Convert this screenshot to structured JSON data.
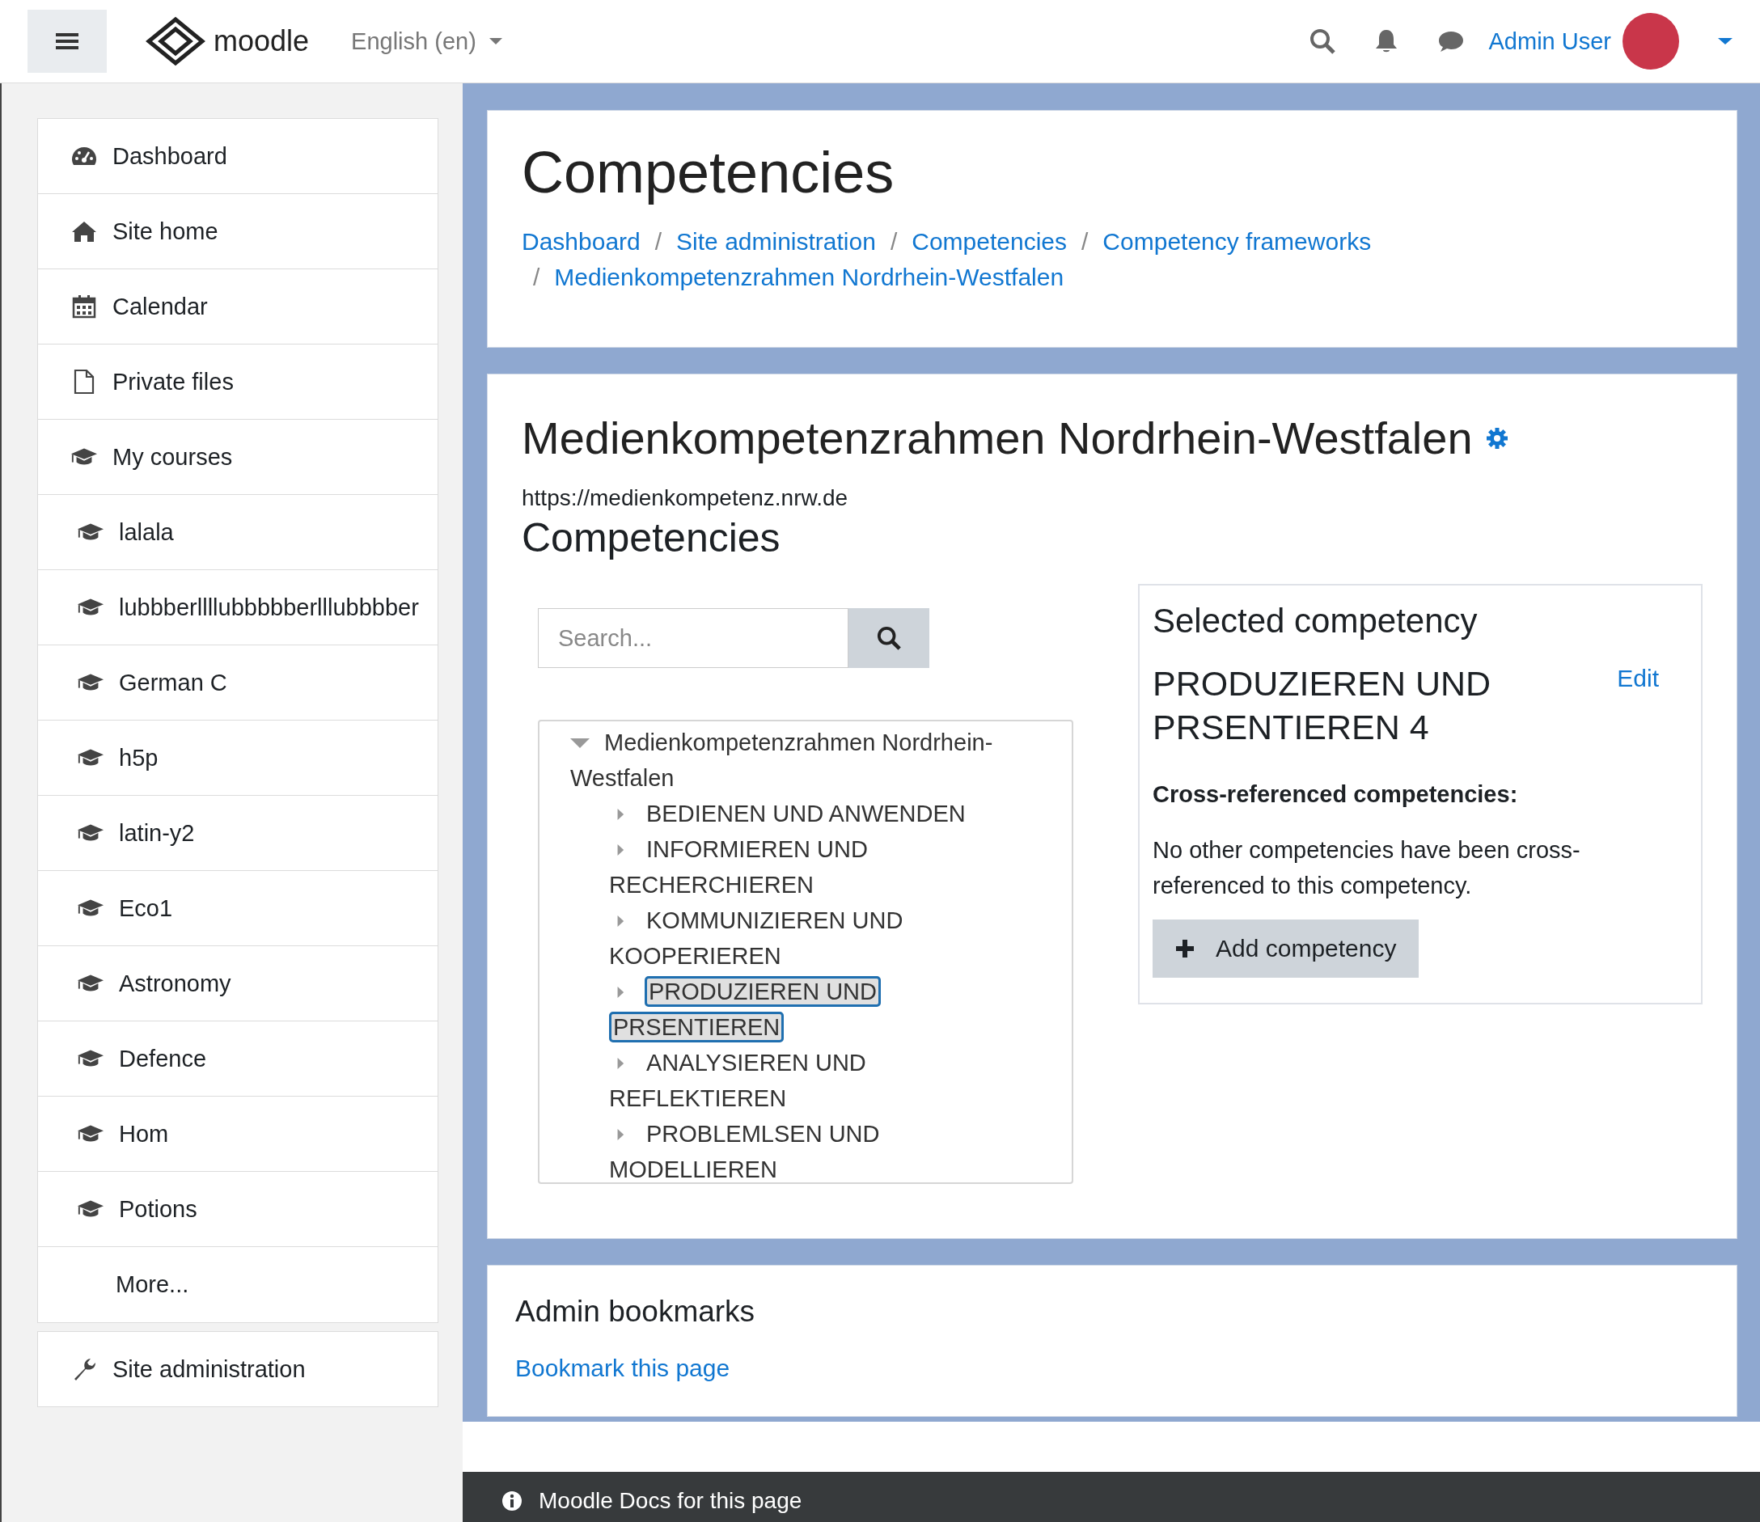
{
  "header": {
    "brand": "moodle",
    "language": "English (en)",
    "user": "Admin User"
  },
  "sidebar": {
    "items": [
      {
        "label": "Dashboard",
        "kind": "nav"
      },
      {
        "label": "Site home",
        "kind": "nav"
      },
      {
        "label": "Calendar",
        "kind": "nav"
      },
      {
        "label": "Private files",
        "kind": "nav"
      },
      {
        "label": "My courses",
        "kind": "nav"
      },
      {
        "label": "lalala",
        "kind": "course"
      },
      {
        "label": "lubbberllllubbbbberlllubbbber",
        "kind": "course"
      },
      {
        "label": "German C",
        "kind": "course"
      },
      {
        "label": "h5p",
        "kind": "course"
      },
      {
        "label": "latin-y2",
        "kind": "course"
      },
      {
        "label": "Eco1",
        "kind": "course"
      },
      {
        "label": "Astronomy",
        "kind": "course"
      },
      {
        "label": "Defence",
        "kind": "course"
      },
      {
        "label": "Hom",
        "kind": "course"
      },
      {
        "label": "Potions",
        "kind": "course"
      },
      {
        "label": "More...",
        "kind": "more"
      }
    ],
    "admin": "Site administration"
  },
  "page": {
    "title": "Competencies",
    "breadcrumb_separator": "/",
    "breadcrumbs": [
      "Dashboard",
      "Site administration",
      "Competencies",
      "Competency frameworks",
      "Medienkompetenzrahmen Nordrhein-Westfalen"
    ]
  },
  "framework": {
    "title": "Medienkompetenzrahmen Nordrhein-Westfalen",
    "url": "https://medienkompetenz.nrw.de",
    "section_title": "Competencies",
    "search": {
      "placeholder": "Search..."
    },
    "tree": [
      {
        "label": "Medienkompetenzrahmen Nordrhein-Westfalen",
        "expanded": true,
        "selected": false,
        "children": [
          {
            "label": "BEDIENEN UND ANWENDEN",
            "expanded": false,
            "selected": false
          },
          {
            "label": "INFORMIEREN UND RECHERCHIEREN",
            "expanded": false,
            "selected": false
          },
          {
            "label": "KOMMUNIZIEREN UND KOOPERIEREN",
            "expanded": false,
            "selected": false
          },
          {
            "label": "PRODUZIEREN UND PRSENTIEREN",
            "expanded": false,
            "selected": true
          },
          {
            "label": "ANALYSIEREN UND REFLEKTIEREN",
            "expanded": false,
            "selected": false
          },
          {
            "label": "PROBLEMLSEN UND MODELLIEREN",
            "expanded": false,
            "selected": false
          }
        ]
      }
    ],
    "selected_panel": {
      "heading": "Selected competency",
      "name": "PRODUZIEREN UND PRSENTIEREN 4",
      "edit": "Edit",
      "cross_heading": "Cross-referenced competencies:",
      "cross_text": "No other competencies have been cross-referenced to this competency.",
      "add_button": "Add competency"
    }
  },
  "bookmarks": {
    "title": "Admin bookmarks",
    "link": "Bookmark this page"
  },
  "footer": {
    "docs_link": "Moodle Docs for this page"
  }
}
